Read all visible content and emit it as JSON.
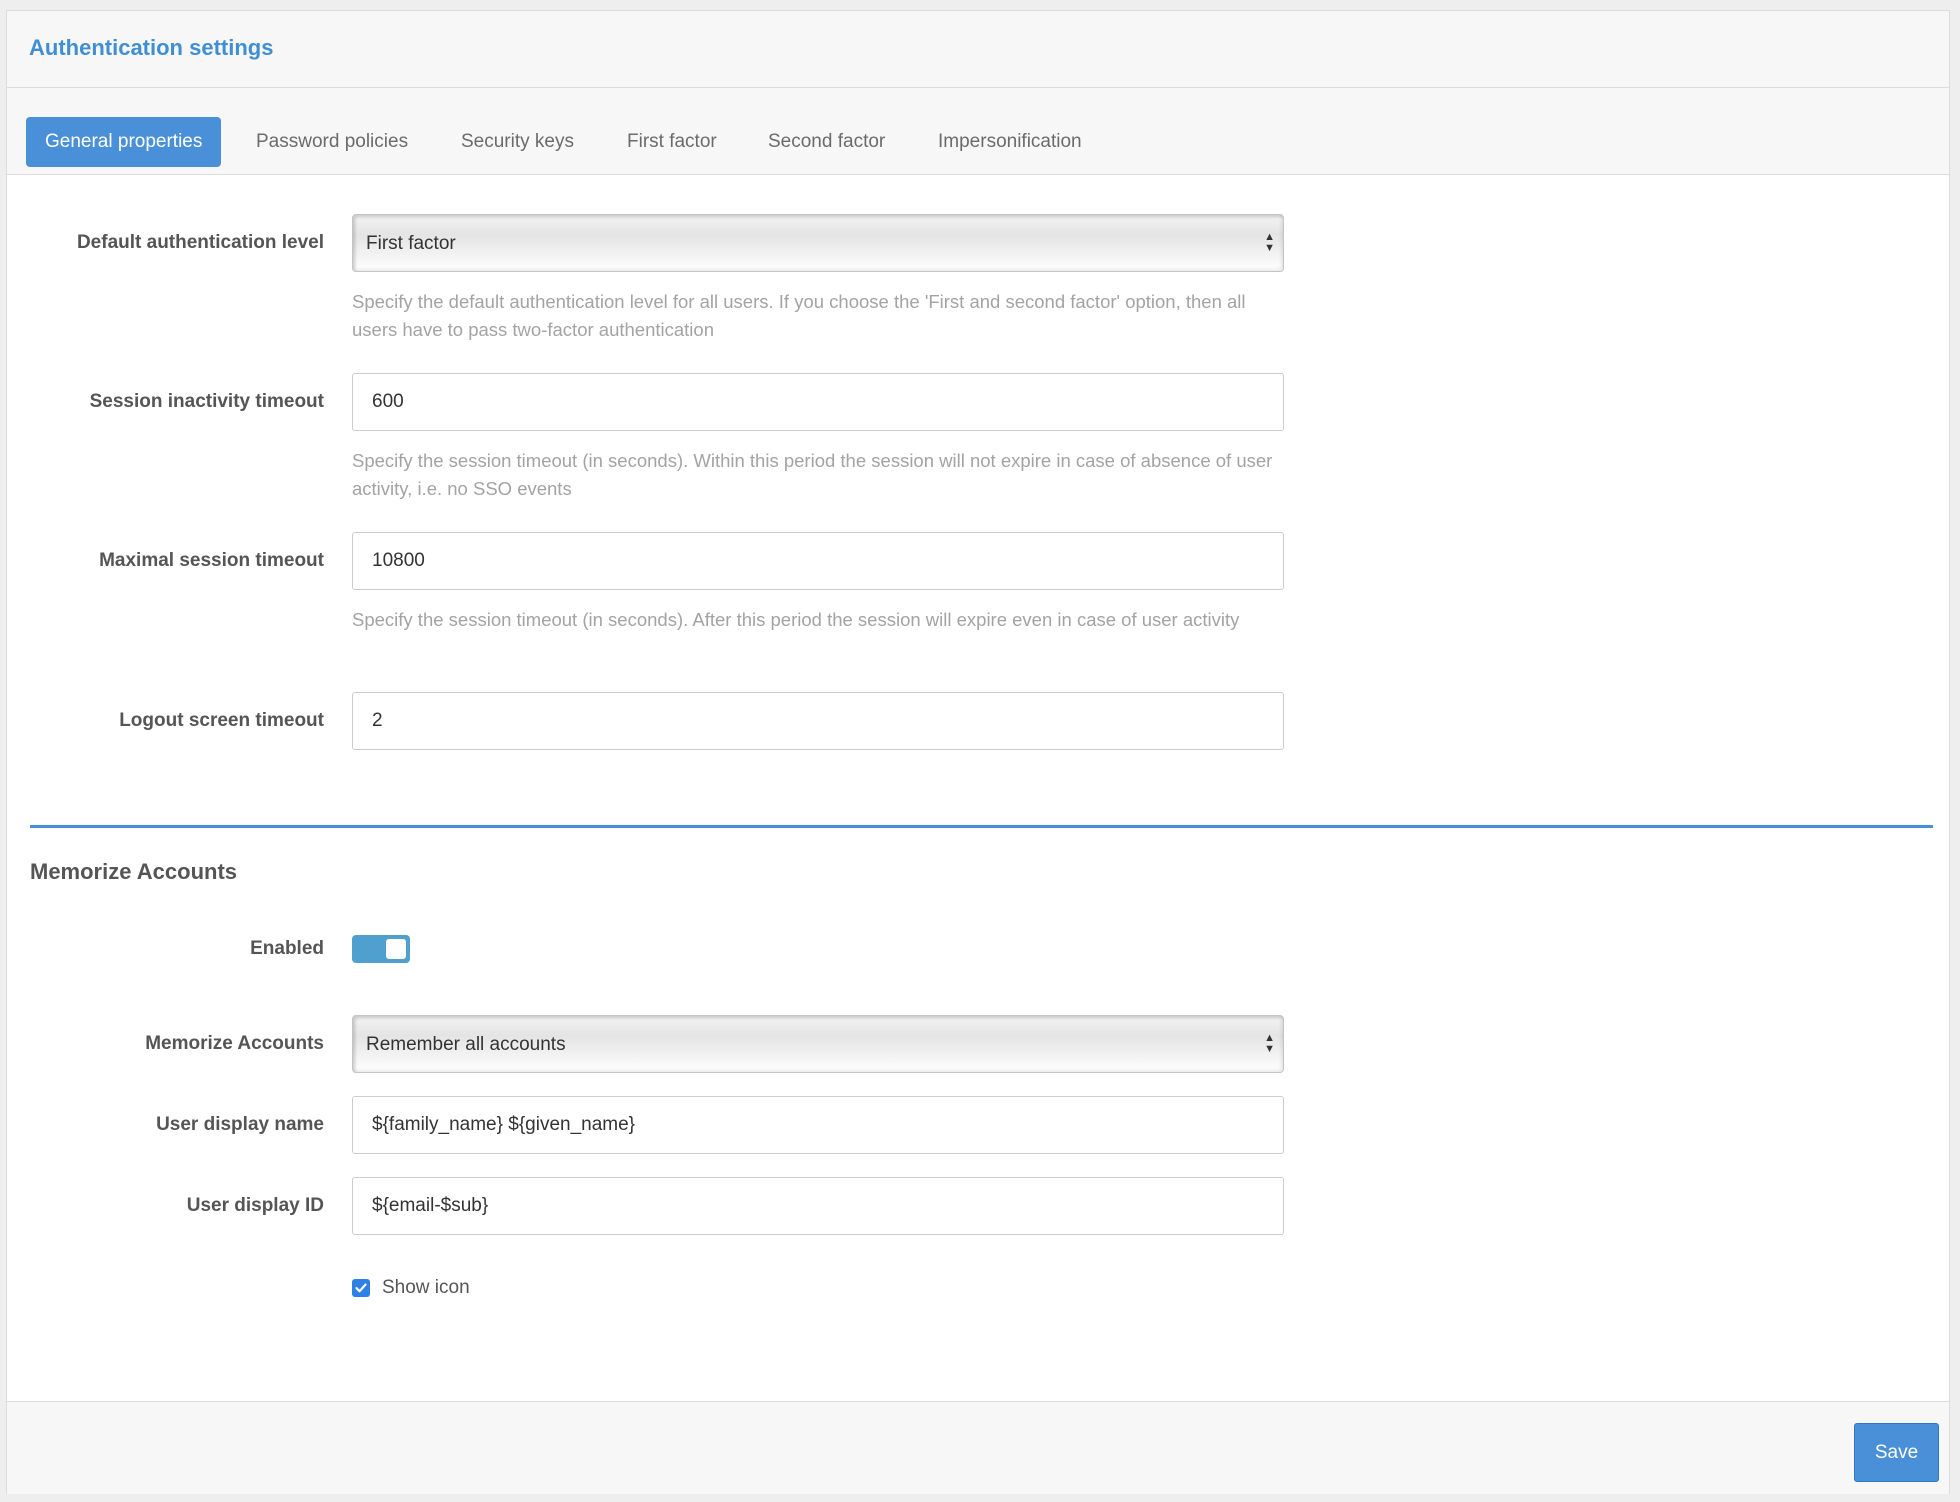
{
  "header": {
    "title": "Authentication settings"
  },
  "tabs": [
    {
      "label": "General properties",
      "active": true
    },
    {
      "label": "Password policies",
      "active": false
    },
    {
      "label": "Security keys",
      "active": false
    },
    {
      "label": "First factor",
      "active": false
    },
    {
      "label": "Second factor",
      "active": false
    },
    {
      "label": "Impersonification",
      "active": false
    }
  ],
  "general": {
    "default_level": {
      "label": "Default authentication level",
      "value": "First factor",
      "help": "Specify the default authentication level for all users. If you choose the 'First and second factor' option, then all users have to pass two-factor authentication"
    },
    "inactivity_timeout": {
      "label": "Session inactivity timeout",
      "value": "600",
      "help": "Specify the session timeout (in seconds). Within this period the session will not expire in case of absence of user activity, i.e. no SSO events"
    },
    "max_timeout": {
      "label": "Maximal session timeout",
      "value": "10800",
      "help": "Specify the session timeout (in seconds). After this period the session will expire even in case of user activity"
    },
    "logout_timeout": {
      "label": "Logout screen timeout",
      "value": "2"
    }
  },
  "memorize": {
    "section_title": "Memorize Accounts",
    "enabled": {
      "label": "Enabled",
      "value": true
    },
    "mode": {
      "label": "Memorize Accounts",
      "value": "Remember all accounts"
    },
    "display_name": {
      "label": "User display name",
      "value": "${family_name} ${given_name}"
    },
    "display_id": {
      "label": "User display ID",
      "value": "${email-$sub}"
    },
    "show_icon": {
      "label": "Show icon",
      "checked": true
    }
  },
  "footer": {
    "save_label": "Save"
  },
  "colors": {
    "accent": "#4a90d9",
    "title": "#3f8fd2",
    "toggle": "#4fa0cf",
    "help_text": "#a3a3a3"
  }
}
